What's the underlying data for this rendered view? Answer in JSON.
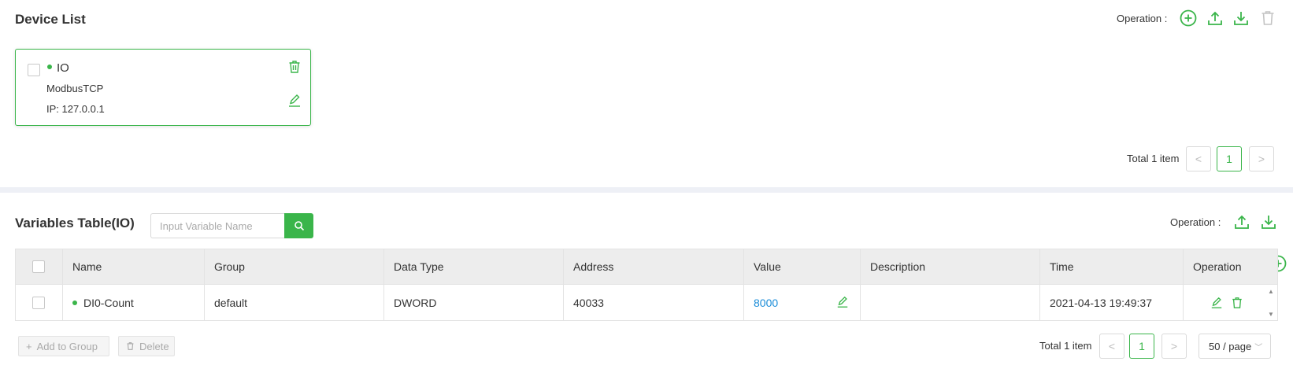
{
  "device_section": {
    "title": "Device List",
    "operation_label": "Operation :",
    "card": {
      "name": "IO",
      "protocol": "ModbusTCP",
      "ip": "IP: 127.0.0.1"
    },
    "pager": {
      "total": "Total 1 item",
      "prev": "<",
      "page": "1",
      "next": ">"
    }
  },
  "variables_section": {
    "title": "Variables Table(IO)",
    "search": {
      "placeholder": "Input Variable Name",
      "value": ""
    },
    "operation_label": "Operation :",
    "columns": [
      "Name",
      "Group",
      "Data Type",
      "Address",
      "Value",
      "Description",
      "Time",
      "Operation"
    ],
    "rows": [
      {
        "name": "DI0-Count",
        "group": "default",
        "data_type": "DWORD",
        "address": "40033",
        "value": "8000",
        "description": "",
        "time": "2021-04-13 19:49:37"
      }
    ],
    "footer": {
      "add_to_group": "Add to Group",
      "delete": "Delete",
      "total": "Total 1 item",
      "prev": "<",
      "page": "1",
      "next": ">",
      "page_size": "50 / page"
    }
  },
  "colors": {
    "accent": "#3ab54a",
    "link": "#1a8cd8",
    "divider": "#eef0f6",
    "header_bg": "#ededed"
  }
}
